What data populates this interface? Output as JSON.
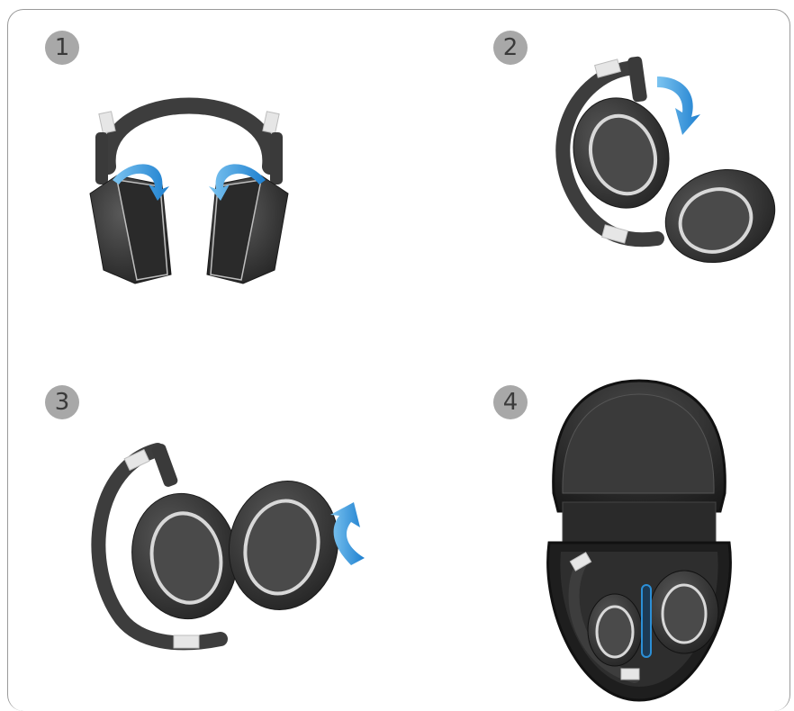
{
  "steps": [
    {
      "number": "1"
    },
    {
      "number": "2"
    },
    {
      "number": "3"
    },
    {
      "number": "4"
    }
  ],
  "colors": {
    "frame": "#9a9a9a",
    "badge": "#a8a8a8",
    "headband": "#3d3d3d",
    "earcup": "#2e2e2e",
    "cushion": "#4a4a4a",
    "silver": "#d8d8d8",
    "arrow": "#2c8fd6",
    "case": "#2a2a2a"
  },
  "icons": [
    "headphones-open",
    "fold-arrow",
    "rotate-arrow",
    "carry-case"
  ]
}
